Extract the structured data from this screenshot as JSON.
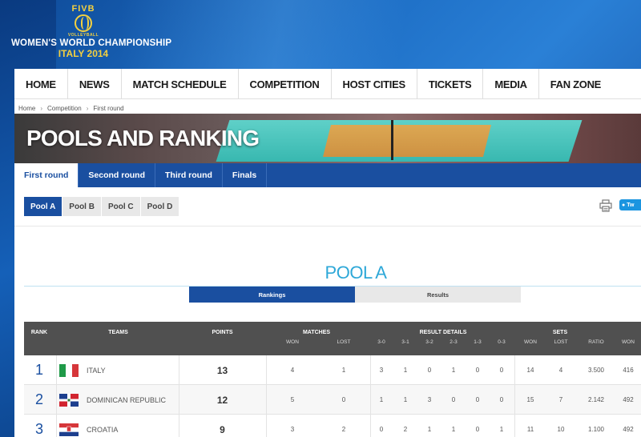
{
  "header": {
    "fivb": "FIVB",
    "small": "VOLLEYBALL",
    "title": "WOMEN'S WORLD CHAMPIONSHIP",
    "subtitle": "ITALY 2014"
  },
  "nav": [
    "HOME",
    "NEWS",
    "MATCH SCHEDULE",
    "COMPETITION",
    "HOST CITIES",
    "TICKETS",
    "MEDIA",
    "FAN ZONE"
  ],
  "breadcrumb": [
    "Home",
    "Competition",
    "First round"
  ],
  "banner_title": "POOLS AND RANKING",
  "round_tabs": [
    "First round",
    "Second round",
    "Third round",
    "Finals"
  ],
  "pool_tabs": [
    "Pool A",
    "Pool B",
    "Pool C",
    "Pool D"
  ],
  "tweet_label": "Tw",
  "pool_title": "POOL A",
  "sub_tabs": [
    "Rankings",
    "Results"
  ],
  "table": {
    "headers": {
      "rank": "RANK",
      "teams": "TEAMS",
      "points": "POINTS",
      "matches": "MATCHES",
      "result_details": "RESULT DETAILS",
      "sets": "SETS",
      "won_extra": "WON"
    },
    "subheaders": {
      "won": "WON",
      "lost": "LOST",
      "r30": "3-0",
      "r31": "3-1",
      "r32": "3-2",
      "r23": "2-3",
      "r13": "1-3",
      "r03": "0-3",
      "sets_won": "WON",
      "sets_lost": "LOST",
      "ratio": "RATIO"
    },
    "rows": [
      {
        "rank": "1",
        "team": "ITALY",
        "flag": "italy",
        "points": "13",
        "won": "4",
        "lost": "1",
        "r30": "3",
        "r31": "1",
        "r32": "0",
        "r23": "1",
        "r13": "0",
        "r03": "0",
        "sets_won": "14",
        "sets_lost": "4",
        "ratio": "3.500",
        "pts_won": "416"
      },
      {
        "rank": "2",
        "team": "DOMINICAN REPUBLIC",
        "flag": "dominican",
        "points": "12",
        "won": "5",
        "lost": "0",
        "r30": "1",
        "r31": "1",
        "r32": "3",
        "r23": "0",
        "r13": "0",
        "r03": "0",
        "sets_won": "15",
        "sets_lost": "7",
        "ratio": "2.142",
        "pts_won": "492"
      },
      {
        "rank": "3",
        "team": "CROATIA",
        "flag": "croatia",
        "points": "9",
        "won": "3",
        "lost": "2",
        "r30": "0",
        "r31": "2",
        "r32": "1",
        "r23": "1",
        "r13": "0",
        "r03": "1",
        "sets_won": "11",
        "sets_lost": "10",
        "ratio": "1.100",
        "pts_won": "492"
      }
    ]
  },
  "colors": {
    "accent": "#1a4fa0",
    "pool_title": "#2ea8d8",
    "table_header": "#505050"
  }
}
